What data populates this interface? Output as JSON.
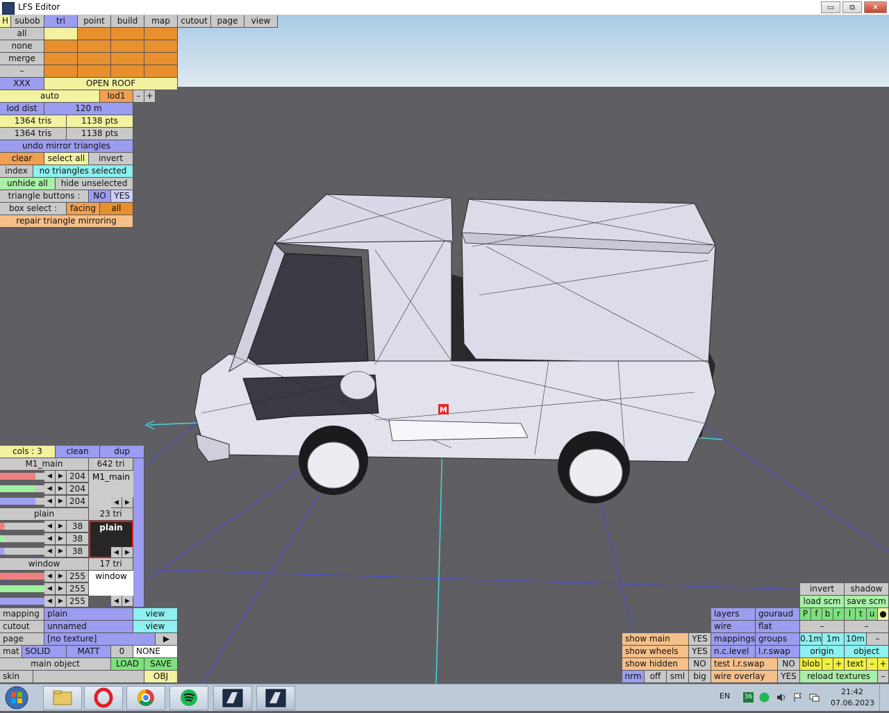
{
  "window": {
    "title": "LFS Editor",
    "minimize": "▭",
    "maximize": "⧉",
    "close": "✕"
  },
  "menu": {
    "h": "H",
    "items": [
      "subob",
      "tri",
      "point",
      "build",
      "map",
      "cutout",
      "page",
      "view"
    ]
  },
  "select": {
    "all": "all",
    "none": "none",
    "merge": "merge",
    "dash": "–",
    "xxx": "XXX",
    "group_name": "OPEN ROOF"
  },
  "lod": {
    "auto": "auto",
    "lod1": "lod1",
    "minus": "–",
    "plus": "+",
    "lod_dist_label": "lod dist",
    "lod_dist_value": "120 m"
  },
  "stats": {
    "tris1": "1364 tris",
    "pts1": "1138 pts",
    "tris2": "1364 tris",
    "pts2": "1138 pts"
  },
  "tri_panel": {
    "undo_mirror": "undo mirror triangles",
    "clear": "clear",
    "select_all": "select all",
    "invert": "invert",
    "index": "index",
    "index_status": "no triangles selected",
    "unhide_all": "unhide all",
    "hide_unselected": "hide unselected",
    "triangle_buttons": "triangle buttons :",
    "no": "NO",
    "yes": "YES",
    "box_select": "box select :",
    "facing": "facing",
    "all": "all",
    "repair": "repair triangle mirroring"
  },
  "colors_panel": {
    "cols": "cols : 3",
    "clean": "clean",
    "dup": "dup",
    "entries": [
      {
        "name": "M1_main",
        "tri": "642 tri",
        "r": "204",
        "g": "204",
        "b": "204",
        "a": "",
        "preview_label": "M1_main",
        "preview_color": "#cccccc",
        "preview_text_color": "#000000"
      },
      {
        "name": "plain",
        "tri": "23 tri",
        "r": "38",
        "g": "38",
        "b": "38",
        "a": "",
        "preview_label": "plain",
        "preview_color": "#262626",
        "preview_text_color": "#ffffff"
      },
      {
        "name": "window",
        "tri": "17 tri",
        "r": "255",
        "g": "255",
        "b": "255",
        "a": "",
        "preview_label": "window",
        "preview_color": "#ffffff",
        "preview_text_color": "#000000"
      }
    ],
    "arrow_left": "◀",
    "arrow_right": "▶"
  },
  "bottom_left": {
    "mapping": "mapping",
    "mapping_value": "plain",
    "view1": "view",
    "cutout": "cutout",
    "cutout_value": "unnamed",
    "view2": "view",
    "page": "page",
    "page_value": "[no texture]",
    "page_arrow": "▶",
    "mat": "mat",
    "solid": "SOLID",
    "matt": "MATT",
    "zero": "0",
    "none": "NONE",
    "main_object": "main object",
    "load": "LOAD",
    "save": "SAVE",
    "skin": "skin",
    "obj": "OBJ"
  },
  "bottom_right": {
    "invert": "invert",
    "shadow": "shadow",
    "load_scm": "load scm",
    "save_scm": "save scm",
    "layers": "layers",
    "gouraud": "gouraud",
    "flags": [
      "P",
      "f",
      "b",
      "r",
      "l",
      "t",
      "u",
      "●"
    ],
    "wire": "wire",
    "flat": "flat",
    "dash1": "–",
    "dash2": "–",
    "show_main": "show main",
    "yes1": "YES",
    "mappings": "mappings",
    "groups": "groups",
    "step1": "0.1m",
    "step2": "1m",
    "step3": "10m",
    "dash3": "–",
    "show_wheels": "show wheels",
    "yes2": "YES",
    "nc_level": "n.c.level",
    "lr_swap": "l.r.swap",
    "origin": "origin",
    "object": "object",
    "show_hidden": "show hidden",
    "no1": "NO",
    "test_lr_swap": "test l.r.swap",
    "no2": "NO",
    "blob": "blob",
    "minus1": "–",
    "plus1": "+",
    "text": "text",
    "minus2": "–",
    "plus2": "+",
    "nrm": "nrm",
    "off": "off",
    "sml": "sml",
    "big": "big",
    "wire_overlay": "wire overlay",
    "yes3": "YES",
    "reload_textures": "reload textures",
    "dash4": "–"
  },
  "viewport": {
    "marker": "M"
  },
  "taskbar": {
    "lang": "EN",
    "badge": "36",
    "time": "21:42",
    "date": "07.06.2023"
  }
}
